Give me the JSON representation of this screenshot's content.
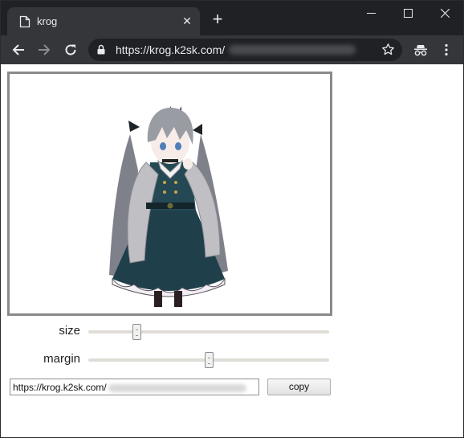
{
  "tab": {
    "title": "krog",
    "close_glyph": "✕"
  },
  "new_tab_glyph": "+",
  "omnibox": {
    "url": "https://krog.k2sk.com/"
  },
  "controls": {
    "size": {
      "label": "size",
      "value": 0.2
    },
    "margin": {
      "label": "margin",
      "value": 0.5
    }
  },
  "output": {
    "url_prefix": "https://krog.k2sk.com/"
  },
  "copy_button": {
    "label": "copy"
  },
  "icons": {
    "tab": "page-icon",
    "back": "arrow-left-icon",
    "forward": "arrow-right-icon",
    "reload": "reload-icon",
    "lock": "lock-icon",
    "star": "star-icon",
    "incognito": "incognito-icon",
    "menu": "kebab-menu-icon"
  },
  "colors": {
    "titlebar": "#202124",
    "toolbar": "#35363a",
    "frame_border": "#8a8a8a"
  }
}
